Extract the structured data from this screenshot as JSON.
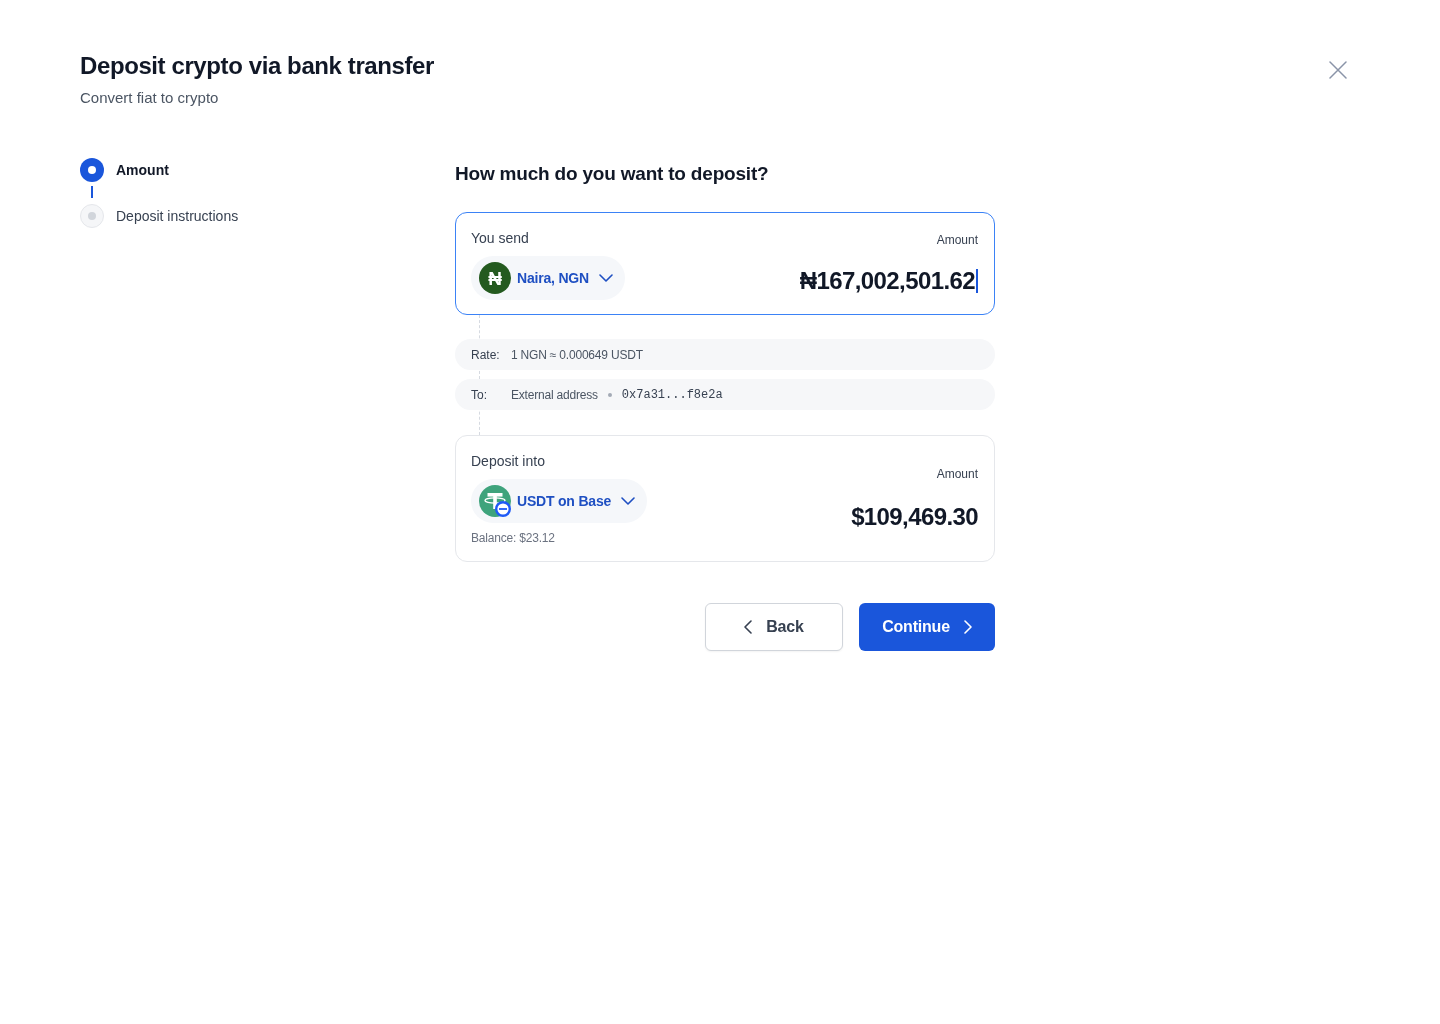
{
  "dialog": {
    "title": "Deposit crypto via bank transfer",
    "subtitle": "Convert fiat to crypto"
  },
  "steps": [
    {
      "label": "Amount",
      "current": true
    },
    {
      "label": "Deposit instructions",
      "current": false
    }
  ],
  "question": "How much do you want to deposit?",
  "send": {
    "label": "You send",
    "currency": {
      "symbol": "₦",
      "name": "Naira, NGN"
    },
    "amount_label": "Amount",
    "amount": "₦167,002,501.62",
    "focused": true
  },
  "details": [
    {
      "label": "Rate:",
      "value": "1 NGN ≈ 0.000649 USDT"
    },
    {
      "label": "To:",
      "value": "External address",
      "address": "0x7a31...f8e2a"
    }
  ],
  "receive": {
    "label": "Deposit into",
    "asset": {
      "name": "USDT on Base"
    },
    "balance": "Balance: $23.12",
    "amount_label": "Amount",
    "amount": "$109,469.30"
  },
  "buttons": [
    {
      "label": "Back",
      "kind": "back"
    },
    {
      "label": "Continue",
      "kind": "continue"
    }
  ]
}
